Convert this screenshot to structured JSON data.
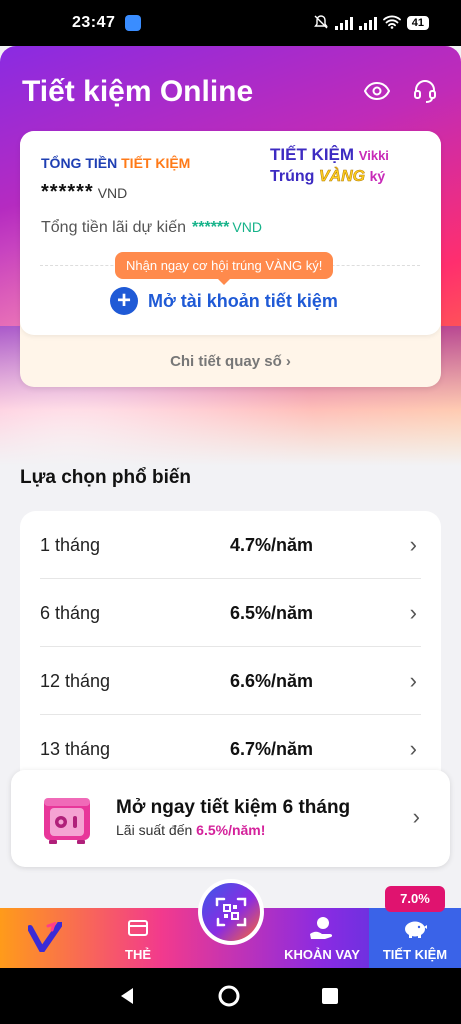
{
  "status_bar": {
    "time": "23:47",
    "battery": "41"
  },
  "header": {
    "title": "Tiết kiệm Online"
  },
  "summary": {
    "total_label_part1": "TỔNG TIỀN ",
    "total_label_part2": "TIẾT KIỆM",
    "total_amount": "******",
    "total_currency": "VND",
    "interest_label": "Tổng tiền lãi dự kiến",
    "interest_amount": "******",
    "interest_currency": "VND",
    "promo_line1": "TIẾT KIỆM",
    "promo_vikki": "Vikki",
    "promo_line2_a": "Trúng",
    "promo_line2_b": "VÀNG",
    "promo_line2_c": "ký",
    "tooltip": "Nhận ngay cơ hội trúng VÀNG ký!",
    "open_account": "Mở tài khoản tiết kiệm",
    "draw_details": "Chi tiết quay số"
  },
  "popular": {
    "title": "Lựa chọn phổ biến",
    "terms": [
      {
        "term": "1 tháng",
        "rate": "4.7%/năm"
      },
      {
        "term": "6 tháng",
        "rate": "6.5%/năm"
      },
      {
        "term": "12 tháng",
        "rate": "6.6%/năm"
      },
      {
        "term": "13 tháng",
        "rate": "6.7%/năm"
      }
    ]
  },
  "banner": {
    "title": "Mở ngay tiết kiệm 6 tháng",
    "subtitle": "Lãi suất đến ",
    "rate": "6.5%/năm!"
  },
  "bottom_nav": {
    "card": "THẺ",
    "loan": "KHOẢN VAY",
    "savings": "TIẾT KIỆM",
    "savings_badge": "7.0%"
  },
  "colors": {
    "accent_blue": "#1f5ad6",
    "brand_pink": "#e0136f",
    "interest_green": "#17b38a"
  }
}
